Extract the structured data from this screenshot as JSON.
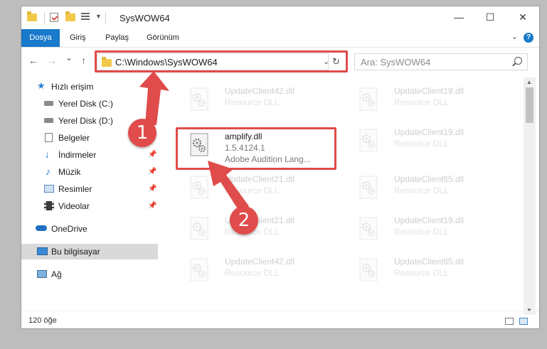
{
  "window": {
    "title": "SysWOW64",
    "minimize": "—",
    "maximize": "☐",
    "close": "✕"
  },
  "ribbon": {
    "tabs": [
      "Dosya",
      "Giriş",
      "Paylaş",
      "Görünüm"
    ],
    "help": "?"
  },
  "nav": {
    "back": "←",
    "forward": "→",
    "recent": "⌄",
    "up": "↑",
    "address": "C:\\Windows\\SysWOW64",
    "search_placeholder": "Ara: SysWOW64"
  },
  "sidebar": {
    "items": [
      {
        "label": "Hızlı erişim",
        "icon": "star-icon"
      },
      {
        "label": "Yerel Disk (C:)",
        "icon": "drive-icon"
      },
      {
        "label": "Yerel Disk (D:)",
        "icon": "drive-icon"
      },
      {
        "label": "Belgeler",
        "icon": "documents-icon"
      },
      {
        "label": "İndirmeler",
        "icon": "download-icon"
      },
      {
        "label": "Müzik",
        "icon": "music-icon"
      },
      {
        "label": "Resimler",
        "icon": "pictures-icon"
      },
      {
        "label": "Videolar",
        "icon": "videos-icon"
      },
      {
        "label": "OneDrive",
        "icon": "cloud-icon"
      },
      {
        "label": "Bu bilgisayar",
        "icon": "computer-icon"
      },
      {
        "label": "Ağ",
        "icon": "network-icon"
      }
    ]
  },
  "files": {
    "selected": {
      "name": "amplify.dll",
      "version": "1.5.4124.1",
      "description": "Adobe Audition Lang..."
    },
    "left": [
      {
        "name": "UpdateClient42.dll",
        "type": "Resource DLL"
      },
      {
        "name": "UpdateClient21.dll",
        "type": "Resource DLL"
      },
      {
        "name": "UpdateClient21.dll",
        "type": "Resource DLL"
      },
      {
        "name": "UpdateClient42.dll",
        "type": "Resource DLL"
      }
    ],
    "right": [
      {
        "name": "UpdateClient19.dll",
        "type": "Resource DLL"
      },
      {
        "name": "UpdateClient19.dll",
        "type": "Resource DLL"
      },
      {
        "name": "UpdateClient65.dll",
        "type": "Resource DLL"
      },
      {
        "name": "UpdateClient19.dll",
        "type": "Resource DLL"
      },
      {
        "name": "UpdateClient65.dll",
        "type": "Resource DLL"
      }
    ]
  },
  "status": {
    "count": "120 öğe"
  },
  "callouts": {
    "one": "1",
    "two": "2"
  },
  "colors": {
    "accent": "#1979ca",
    "highlight": "#e04b4b",
    "folder": "#f3c94b"
  }
}
